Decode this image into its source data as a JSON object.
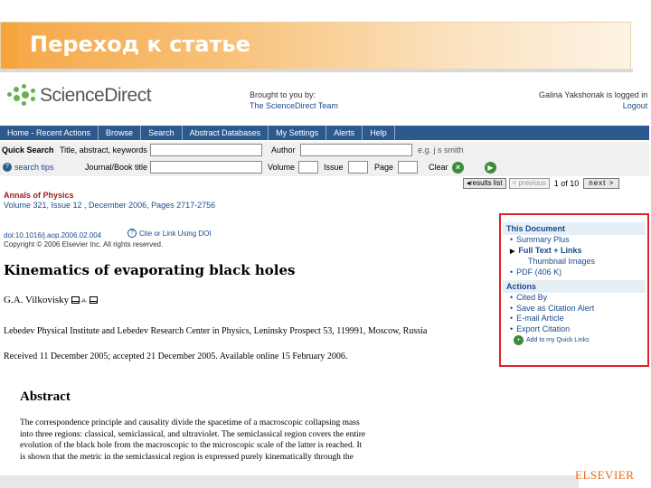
{
  "slide": {
    "title": "Переход к статье"
  },
  "brand": {
    "logo_text": "ScienceDirect",
    "logo_icon": "sciencedirect-dots-icon",
    "publisher": "ELSEVIER"
  },
  "header": {
    "brought_line1": "Brought to you by:",
    "brought_line2": "The ScienceDirect Team",
    "logged_in": "Galina Yakshonak is logged in",
    "logout": "Logout"
  },
  "nav": {
    "items": [
      "Home - Recent Actions",
      "Browse",
      "Search",
      "Abstract Databases",
      "My Settings",
      "Alerts",
      "Help"
    ]
  },
  "quick_search": {
    "label": "Quick Search",
    "field1_label": "Title, abstract, keywords",
    "author_label": "Author",
    "author_example": "e.g. j s smith",
    "search_tips": "search tips",
    "journal_label": "Journal/Book title",
    "volume_label": "Volume",
    "issue_label": "Issue",
    "page_label": "Page",
    "clear_label": "Clear"
  },
  "results_nav": {
    "results_list": "results list",
    "previous": "< previous",
    "counter": "1 of 10",
    "next": "next >"
  },
  "article": {
    "journal": "Annals of Physics",
    "volume_line": "Volume 321, Issue 12 , December 2006, Pages 2717-2756",
    "doi": "doi:10.1016/j.aop.2006.02.004",
    "cite_link": "Cite or Link Using DOI",
    "copyright": "Copyright © 2006 Elsevier Inc. All rights reserved.",
    "title": "Kinematics of evaporating black holes",
    "author": "G.A. Vilkovisky",
    "affiliation": "Lebedev Physical Institute and Lebedev Research Center in Physics, Leninsky Prospect 53, 119991, Moscow, Russia",
    "received": "Received 11 December 2005;  accepted 21 December 2005.  Available online 15 February 2006."
  },
  "abstract": {
    "heading": "Abstract",
    "lines": [
      "The correspondence principle and causality divide the spacetime of a macroscopic collapsing mass",
      "into three regions: classical, semiclassical, and ultraviolet. The semiclassical region covers the entire",
      "evolution of the black hole from the macroscopic to the microscopic scale of the latter is reached. It",
      "is shown that the metric in the semiclassical region is expressed purely kinematically through the"
    ]
  },
  "sidebar": {
    "this_document": "This Document",
    "doc_items": [
      "Summary Plus",
      "Full Text + Links",
      "Thumbnail Images",
      "PDF (406 K)"
    ],
    "actions": "Actions",
    "action_items": [
      "Cited By",
      "Save as Citation Alert",
      "E-mail Article",
      "Export Citation"
    ],
    "add_to": "Add to my Quick Links"
  },
  "colors": {
    "accent": "#f3a43a",
    "nav_bg": "#2d5a8e",
    "highlight_border": "#e0202a",
    "link": "#1a4b8c",
    "journal": "#a02020"
  }
}
